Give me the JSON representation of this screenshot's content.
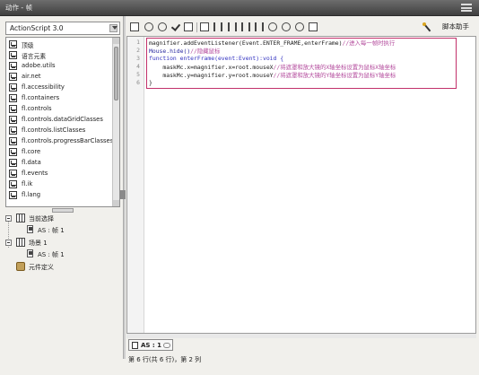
{
  "window": {
    "title": "动作 - 帧"
  },
  "sidebar": {
    "language": "ActionScript 3.0",
    "library": [
      "顶级",
      "语言元素",
      "adobe.utils",
      "air.net",
      "fl.accessibility",
      "fl.containers",
      "fl.controls",
      "fl.controls.dataGridClasses",
      "fl.controls.listClasses",
      "fl.controls.progressBarClasses",
      "fl.core",
      "fl.data",
      "fl.events",
      "fl.ik",
      "fl.lang"
    ],
    "tree": {
      "current": "当前选择",
      "current_child": "AS : 帧 1",
      "scene": "场景 1",
      "scene_child": "AS : 帧 1",
      "symbols": "元件定义"
    }
  },
  "toolbar": {
    "icons": [
      "add-icon",
      "find-icon",
      "target-icon",
      "check-syntax-icon",
      "auto-format-icon",
      "code-hint-icon",
      "debug-icon",
      "collapse-icon",
      "collapse-selection-icon",
      "expand-icon",
      "block-comment-icon",
      "line-comment-icon",
      "remove-comment-icon",
      "show-hide-toolbox-icon"
    ],
    "helper_label": "脚本助手"
  },
  "editor": {
    "line_numbers": [
      "1",
      "2",
      "3",
      "4",
      "5",
      "6"
    ],
    "lines": [
      {
        "code": "magnifier.addEventListener(Event.ENTER_FRAME,enterFrame)",
        "comment": "//进入每一帧时执行"
      },
      {
        "code": "Mouse.hide()",
        "comment": "//隐藏鼠标"
      },
      {
        "code": "function enterFrame(event:Event):void {",
        "comment": ""
      },
      {
        "code": "    maskMc.x=magnifier.x=root.mouseX",
        "comment": "//将遮罩和放大镜的X轴坐标设置为鼠标X轴坐标"
      },
      {
        "code": "    maskMc.y=magnifier.y=root.mouseY",
        "comment": "//将遮罩和放大镜的Y轴坐标设置为鼠标Y轴坐标"
      },
      {
        "code": "}",
        "comment": ""
      }
    ]
  },
  "file_tab": "AS : 1",
  "status": "第 6 行(共 6 行)，第 2 列"
}
